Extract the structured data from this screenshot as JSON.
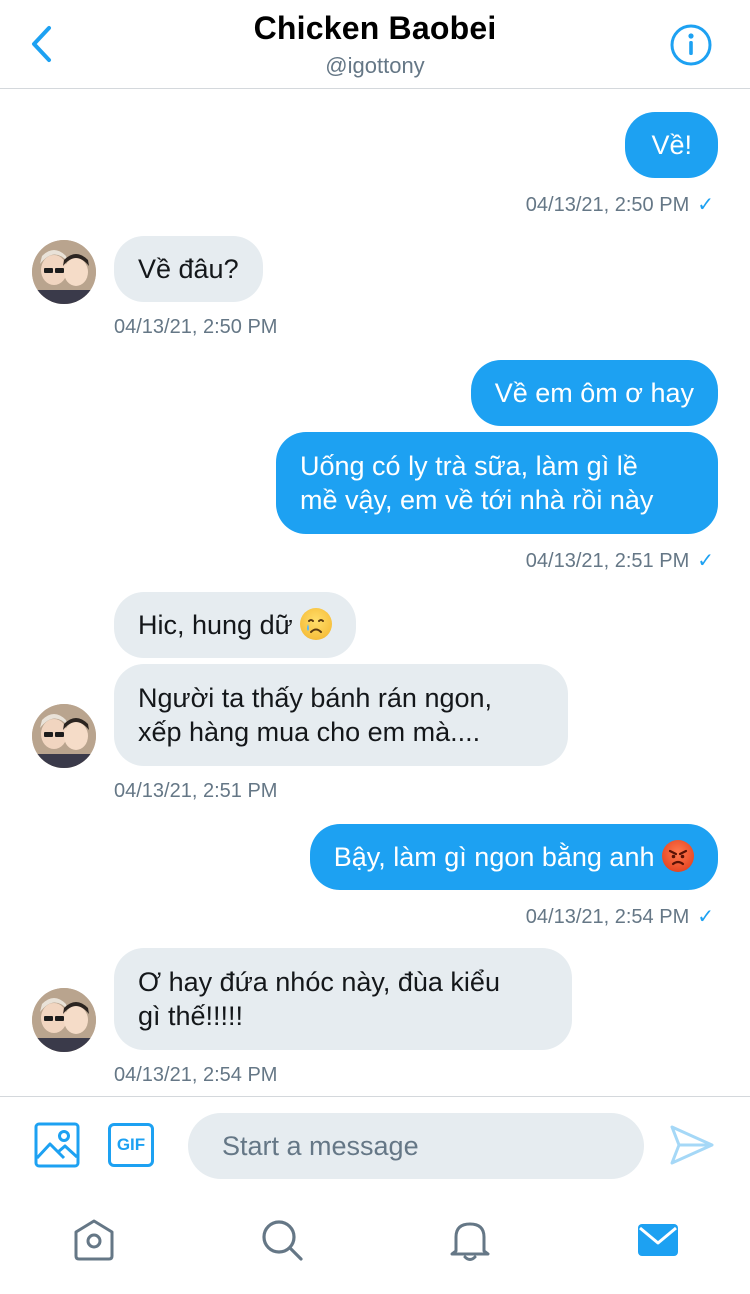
{
  "header": {
    "title": "Chicken Baobei",
    "handle": "@igottony"
  },
  "messages": [
    {
      "dir": "out",
      "text": "Về!"
    },
    {
      "dir": "out",
      "timestamp": "04/13/21, 2:50 PM",
      "read": "✓"
    },
    {
      "dir": "in",
      "text": "Về đâu?"
    },
    {
      "dir": "in",
      "timestamp": "04/13/21, 2:50 PM"
    },
    {
      "dir": "out",
      "text": "Về em ôm ơ hay"
    },
    {
      "dir": "out",
      "text_line1": "Uống có ly trà sữa, làm gì lề",
      "text_line2": "mề vậy, em về tới nhà rồi này"
    },
    {
      "dir": "out",
      "timestamp": "04/13/21, 2:51 PM",
      "read": "✓"
    },
    {
      "dir": "in",
      "text": "Hic, hung dữ",
      "emoji": "crying-face"
    },
    {
      "dir": "in",
      "text_line1": "Người ta thấy bánh rán ngon,",
      "text_line2": "xếp hàng mua cho em mà...."
    },
    {
      "dir": "in",
      "timestamp": "04/13/21, 2:51 PM"
    },
    {
      "dir": "out",
      "text": "Bậy, làm gì ngon bằng anh",
      "emoji": "angry-face"
    },
    {
      "dir": "out",
      "timestamp": "04/13/21, 2:54 PM",
      "read": "✓"
    },
    {
      "dir": "in",
      "text_line1": "Ơ hay đứa nhóc này, đùa kiểu",
      "text_line2": "gì thế!!!!!"
    },
    {
      "dir": "in",
      "timestamp": "04/13/21, 2:54 PM"
    }
  ],
  "composer": {
    "gif_label": "GIF",
    "placeholder": "Start a message"
  },
  "tabs": [
    "home-icon",
    "search-icon",
    "notifications-icon",
    "messages-icon"
  ],
  "colors": {
    "accent": "#1da1f2",
    "incoming_bubble": "#e6ecf0",
    "secondary_text": "#657786"
  }
}
